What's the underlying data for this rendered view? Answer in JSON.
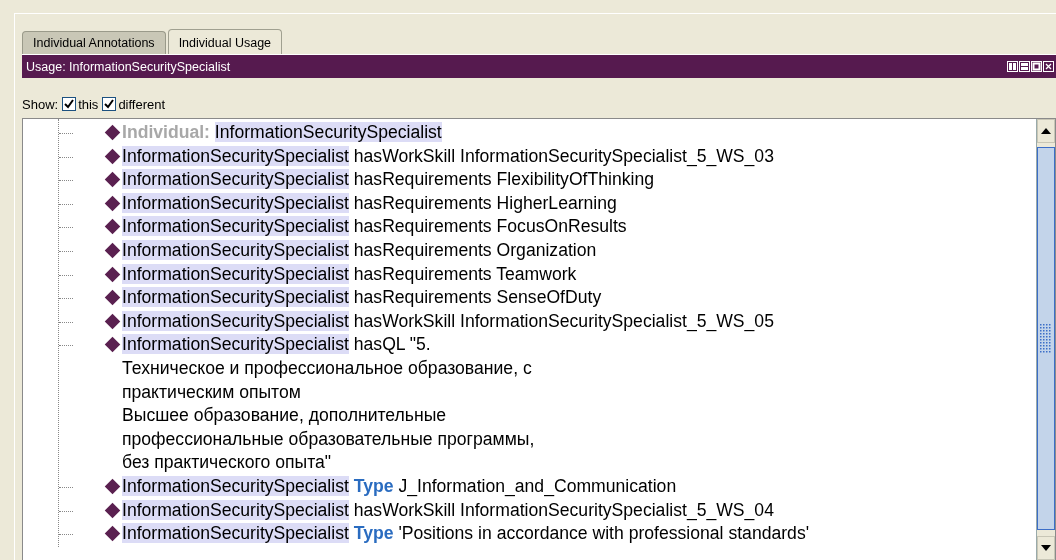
{
  "tabs": [
    {
      "label": "Individual Annotations",
      "selected": false
    },
    {
      "label": "Individual Usage",
      "selected": true
    }
  ],
  "panel": {
    "title": "Usage: InformationSecuritySpecialist"
  },
  "show": {
    "label": "Show:",
    "options": [
      {
        "label": "this",
        "checked": true
      },
      {
        "label": "different",
        "checked": true
      }
    ]
  },
  "tree": {
    "rows": [
      {
        "kind": "header",
        "label": "Individual:",
        "subject": "InformationSecuritySpecialist"
      },
      {
        "kind": "axiom",
        "subject": "InformationSecuritySpecialist",
        "predicate": "hasWorkSkill",
        "keyword": false,
        "object": [
          "InformationSecuritySpecialist_5_WS_03"
        ]
      },
      {
        "kind": "axiom",
        "subject": "InformationSecuritySpecialist",
        "predicate": "hasRequirements",
        "keyword": false,
        "object": [
          "FlexibilityOfThinking"
        ]
      },
      {
        "kind": "axiom",
        "subject": "InformationSecuritySpecialist",
        "predicate": "hasRequirements",
        "keyword": false,
        "object": [
          "HigherLearning"
        ]
      },
      {
        "kind": "axiom",
        "subject": "InformationSecuritySpecialist",
        "predicate": "hasRequirements",
        "keyword": false,
        "object": [
          "FocusOnResults"
        ]
      },
      {
        "kind": "axiom",
        "subject": "InformationSecuritySpecialist",
        "predicate": "hasRequirements",
        "keyword": false,
        "object": [
          "Organization"
        ]
      },
      {
        "kind": "axiom",
        "subject": "InformationSecuritySpecialist",
        "predicate": "hasRequirements",
        "keyword": false,
        "object": [
          "Teamwork"
        ]
      },
      {
        "kind": "axiom",
        "subject": "InformationSecuritySpecialist",
        "predicate": "hasRequirements",
        "keyword": false,
        "object": [
          "SenseOfDuty"
        ]
      },
      {
        "kind": "axiom",
        "subject": "InformationSecuritySpecialist",
        "predicate": "hasWorkSkill",
        "keyword": false,
        "object": [
          "InformationSecuritySpecialist_5_WS_05"
        ]
      },
      {
        "kind": "axiom",
        "subject": "InformationSecuritySpecialist",
        "predicate": "hasQL",
        "keyword": false,
        "object": [
          "\"5.",
          "Техническое и профессиональное образование, с",
          "практическим опытом",
          "Высшее образование, дополнительные",
          "профессиональные образовательные программы,",
          "без практического опыта\""
        ]
      },
      {
        "kind": "axiom",
        "subject": "InformationSecuritySpecialist",
        "predicate": "Type",
        "keyword": true,
        "object": [
          "J_Information_and_Communication"
        ]
      },
      {
        "kind": "axiom",
        "subject": "InformationSecuritySpecialist",
        "predicate": "hasWorkSkill",
        "keyword": false,
        "object": [
          "InformationSecuritySpecialist_5_WS_04"
        ]
      },
      {
        "kind": "axiom",
        "subject": "InformationSecuritySpecialist",
        "predicate": "Type",
        "keyword": true,
        "object": [
          "'Positions in accordance with professional standards'"
        ]
      }
    ]
  }
}
